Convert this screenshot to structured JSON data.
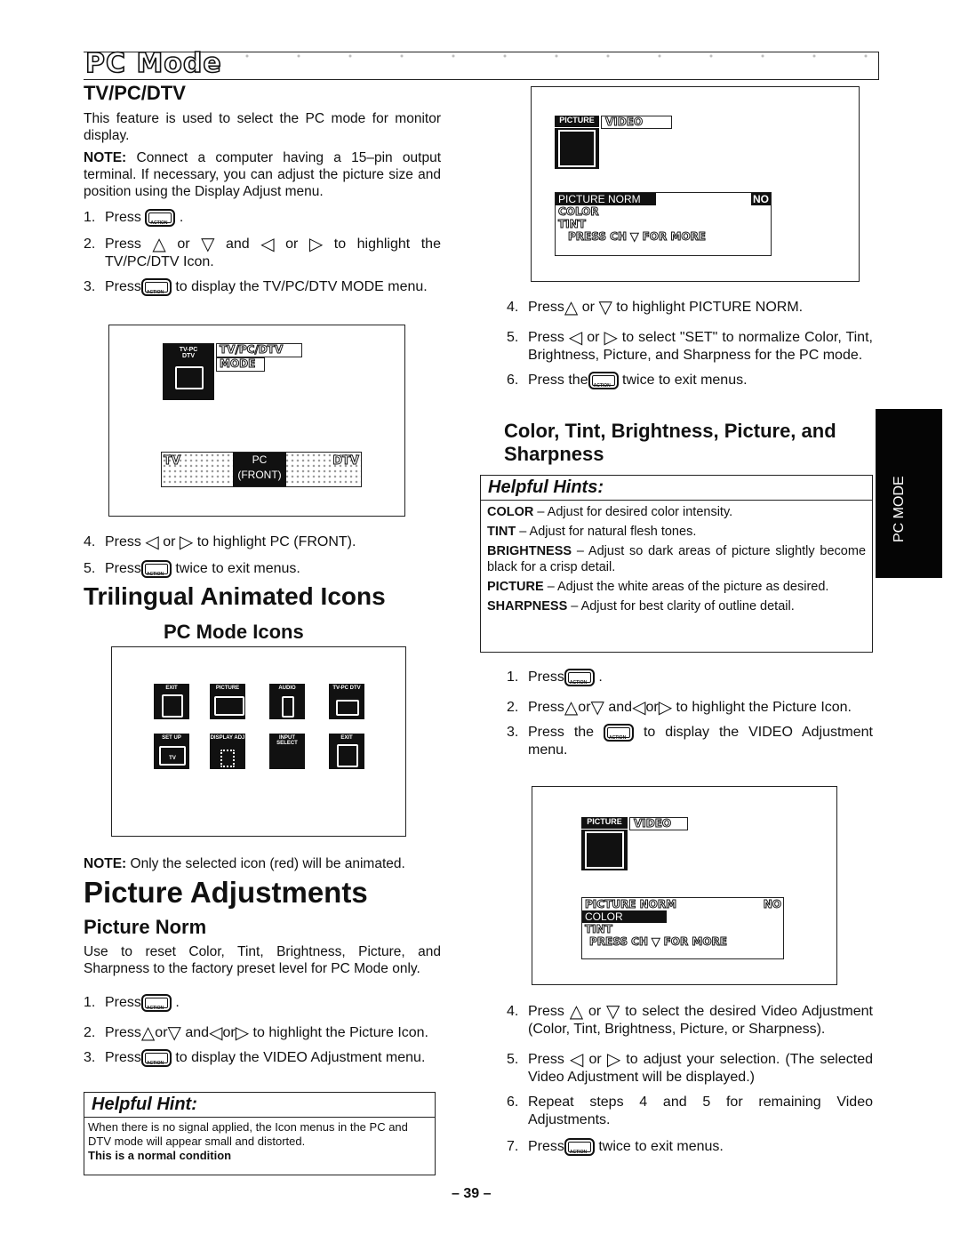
{
  "page": {
    "section_banner": "PC Mode",
    "side_tab": "PC MODE",
    "page_number": "– 39 –"
  },
  "tvpcdtv": {
    "heading": "TV/PC/DTV",
    "intro": "This feature is used to select the PC mode for monitor display.",
    "note_label": "NOTE:",
    "note": "Connect a computer having a 15–pin output terminal. If necessary, you can adjust the picture size and position using the Display Adjust menu.",
    "steps": [
      {
        "num": "1.",
        "text": "Press",
        "after": "."
      },
      {
        "num": "2.",
        "text": "Press",
        "mid1": "or",
        "mid2": "and",
        "mid3": "or",
        "after": "to highlight the TV/PC/DTV Icon."
      },
      {
        "num": "3.",
        "text": "Press",
        "after": "to display the TV/PC/DTV MODE menu."
      }
    ],
    "screen": {
      "icon_label_line1": "TV-PC",
      "icon_label_line2": "DTV",
      "menu_title_line1": "TV/PC/DTV",
      "menu_title_line2": "MODE",
      "options": [
        "TV",
        "PC (FRONT)",
        "DTV"
      ],
      "selected_option": "PC (FRONT)"
    },
    "steps2": [
      {
        "num": "4.",
        "text": "Press",
        "mid1": "or",
        "after": "to highlight PC (FRONT)."
      },
      {
        "num": "5.",
        "text": "Press",
        "after": "twice to exit menus."
      }
    ]
  },
  "trilingual": {
    "heading": "Trilingual Animated Icons",
    "subheading": "PC Mode Icons",
    "icons": [
      "EXIT",
      "PICTURE",
      "AUDIO",
      "TV-PC DTV",
      "SET UP",
      "DISPLAY ADJ",
      "INPUT SELECT",
      "EXIT"
    ],
    "setup_sub": "TV",
    "note_label": "NOTE:",
    "note": "Only the selected icon (red) will be animated."
  },
  "picture_adjustments": {
    "heading": "Picture Adjustments",
    "norm_heading": "Picture Norm",
    "norm_intro": "Use to reset Color, Tint, Brightness, Picture, and Sharpness to the factory preset level for PC Mode only.",
    "steps": [
      {
        "num": "1.",
        "text": "Press",
        "after": "."
      },
      {
        "num": "2.",
        "text": "Press",
        "mid1": "or",
        "mid2": "and",
        "mid3": "or",
        "after": "to highlight the Picture Icon."
      },
      {
        "num": "3.",
        "text": "Press",
        "after": "to display the VIDEO Adjustment menu."
      }
    ],
    "hint": {
      "title": "Helpful Hint:",
      "body": "When there is no signal applied, the Icon menus in the PC and DTV mode will appear small and distorted.",
      "bold": "This is a normal condition"
    }
  },
  "right_col": {
    "screen1": {
      "tab": "PICTURE",
      "title": "VIDEO",
      "rows": [
        "PICTURE NORM",
        "COLOR",
        "TINT"
      ],
      "norm_value": "NO",
      "footer": "PRESS CH ▼ FOR MORE",
      "highlighted_row": "PICTURE NORM"
    },
    "steps_a": [
      {
        "num": "4.",
        "text": "Press",
        "mid1": "or",
        "after": "to highlight PICTURE NORM."
      },
      {
        "num": "5.",
        "text": "Press",
        "mid1": "or",
        "after": "to select \"SET\" to normalize Color, Tint, Brightness, Picture, and Sharpness for the PC mode."
      },
      {
        "num": "6.",
        "text": "Press the",
        "after": "twice to exit menus."
      }
    ],
    "color_heading": "Color, Tint, Brightness, Picture, and Sharpness",
    "hints": {
      "title": "Helpful Hints:",
      "items": [
        {
          "term": "COLOR",
          "desc": "– Adjust for desired color intensity."
        },
        {
          "term": "TINT",
          "desc": "– Adjust for natural flesh tones."
        },
        {
          "term": "BRIGHTNESS",
          "desc": "– Adjust so dark areas of picture slightly become black for a crisp detail."
        },
        {
          "term": "PICTURE",
          "desc": "– Adjust the white areas of the picture as desired."
        },
        {
          "term": "SHARPNESS",
          "desc": "– Adjust for best clarity of outline detail."
        }
      ]
    },
    "steps_b": [
      {
        "num": "1.",
        "text": "Press",
        "after": "."
      },
      {
        "num": "2.",
        "text": "Press",
        "mid1": "or",
        "mid2": "and",
        "mid3": "or",
        "after": "to highlight the Picture Icon."
      },
      {
        "num": "3.",
        "text": "Press the",
        "after": "to display the VIDEO Adjustment menu."
      }
    ],
    "screen2": {
      "tab": "PICTURE",
      "title": "VIDEO",
      "rows": [
        "PICTURE NORM",
        "COLOR",
        "TINT"
      ],
      "norm_value": "NO",
      "footer": "PRESS CH ▼ FOR MORE",
      "highlighted_row": "COLOR"
    },
    "steps_c": [
      {
        "num": "4.",
        "text": "Press",
        "mid1": "or",
        "after": "to select the desired Video Adjustment (Color, Tint, Brightness, Picture, or Sharpness)."
      },
      {
        "num": "5.",
        "text": "Press",
        "mid1": "or",
        "after": "to adjust your selection. (The selected Video Adjustment will be displayed.)"
      },
      {
        "num": "6.",
        "text": "Repeat steps 4 and 5 for remaining Video Adjustments."
      },
      {
        "num": "7.",
        "text": "Press",
        "after": "twice to exit menus."
      }
    ]
  },
  "icons": {
    "action_button": "action-button-icon",
    "ch_up": "ch-up-icon",
    "ch_down": "ch-down-icon",
    "vol_left": "vol-left-icon",
    "vol_right": "vol-right-icon"
  }
}
